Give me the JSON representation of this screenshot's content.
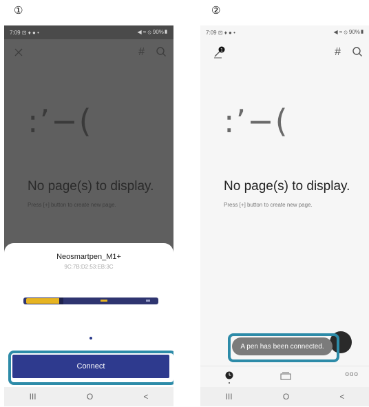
{
  "steps": [
    "①",
    "②"
  ],
  "phone1": {
    "status": {
      "time": "7:09",
      "left_icons": "⊡ ♦ ● •",
      "right": "◀︎ ≈ ⦸ 90%▮"
    },
    "topbar": {
      "hash": "#"
    },
    "empty_state": {
      "face": ":’−(",
      "title": "No page(s) to display.",
      "subtitle": "Press [+] button to create new page."
    },
    "sheet": {
      "device_name": "Neosmartpen_M1+",
      "device_mac": "9C:7B:D2:53:EB:3C",
      "connect_label": "Connect"
    },
    "nav": {
      "recents": "III",
      "home": "O",
      "back": "<"
    }
  },
  "phone2": {
    "status": {
      "time": "7:09",
      "left_icons": "⊡ ♦ ● •",
      "right": "◀︎ ≈ ⦸ 90%▮"
    },
    "topbar": {
      "hash": "#"
    },
    "empty_state": {
      "face": ":’−(",
      "title": "No page(s) to display.",
      "subtitle": "Press [+] button to create new page."
    },
    "toast": "A pen has been connected.",
    "tab_more": "ooo",
    "nav": {
      "recents": "III",
      "home": "O",
      "back": "<"
    }
  },
  "colors": {
    "primary": "#2e3a8e",
    "highlight": "#2d8ba8",
    "pen_accent": "#e6b422"
  }
}
